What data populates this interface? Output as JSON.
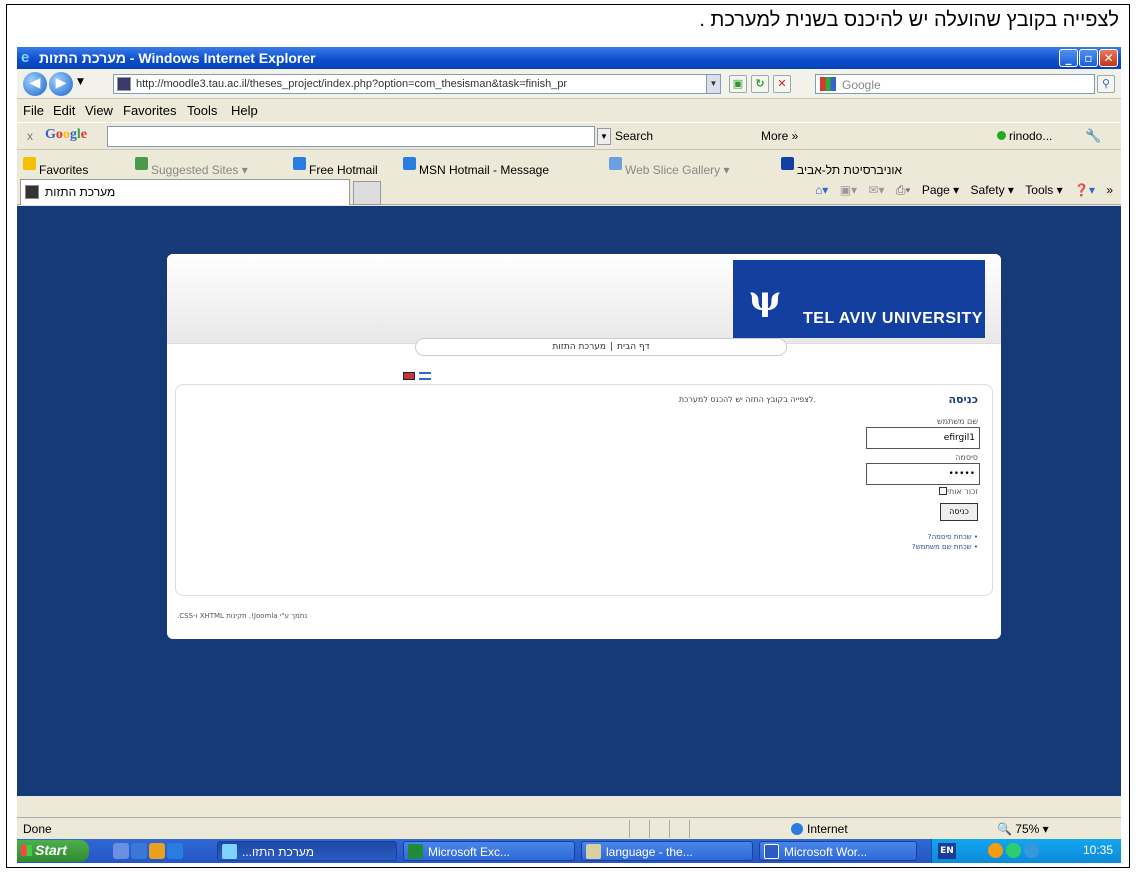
{
  "caption": "לצפייה בקובץ שהועלה יש להיכנס בשנית למערכת .",
  "window": {
    "title_rtl": "מערכת התזות",
    "title_app": " - Windows Internet Explorer"
  },
  "address": {
    "url": "http://moodle3.tau.ac.il/theses_project/index.php?option=com_thesisman&task=finish_pr",
    "search_placeholder": "Google"
  },
  "menu": [
    "File",
    "Edit",
    "View",
    "Favorites",
    "Tools",
    "Help"
  ],
  "google_bar": {
    "close": "x",
    "logo": "Google",
    "search": "Search",
    "more": "More »",
    "user": "rinodo..."
  },
  "favorites": {
    "label": "Favorites",
    "items": [
      "Suggested Sites ▾",
      "Free Hotmail",
      "MSN Hotmail - Message",
      "Web Slice Gallery ▾",
      "אוניברסיטת תל-אביב"
    ]
  },
  "tab": {
    "label": "מערכת התזות"
  },
  "commands": [
    "Page ▾",
    "Safety ▾",
    "Tools ▾"
  ],
  "page": {
    "logo_text": "TEL AVIV UNIVERSITY",
    "logo_emblem": "ψ",
    "breadcrumbs": [
      "דף הבית",
      "מערכת התזות"
    ],
    "login_title": "כניסה",
    "message": ".לצפייה בקובץ התזה יש להכנס למערכת",
    "username_label": "שם משתמש",
    "username_value": "efirgil1",
    "password_label": "סיסמה",
    "password_value": "•••••",
    "remember_label": "זכור אותי",
    "login_button": "כניסה",
    "links": [
      "שכחת סיסמה?",
      "שכחת שם משתמש?"
    ],
    "footer": "נתמך ע\"י Joomla!. תקינות XHTML ו-CSS."
  },
  "status": {
    "text": "Done",
    "zone": "Internet",
    "zoom": "75%"
  },
  "taskbar": {
    "start": "Start",
    "items": [
      "מערכת התזו...",
      "Microsoft Exc...",
      "language - the...",
      "Microsoft Wor..."
    ],
    "lang": "EN",
    "time": "10:35"
  }
}
